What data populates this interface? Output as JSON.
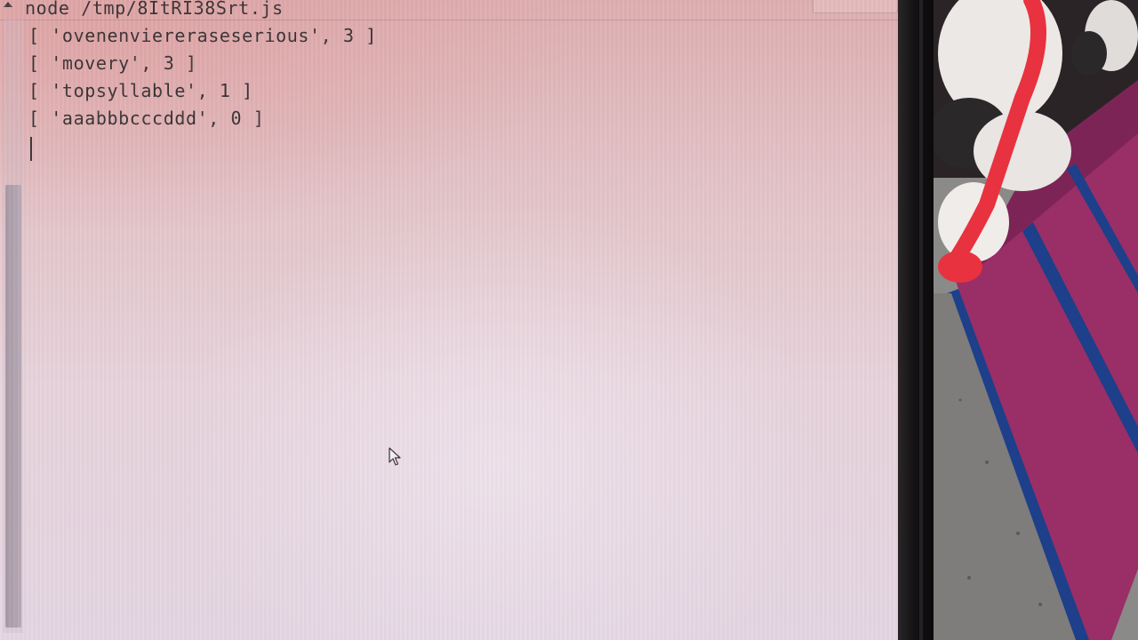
{
  "terminal": {
    "command": "node /tmp/8ItRI38Srt.js",
    "output": [
      "[ 'ovenenviereraseserious', 3 ]",
      "[ 'movery', 3 ]",
      "[ 'topsyllable', 1 ]",
      "[ 'aaabbbcccddd', 0 ]"
    ]
  },
  "icons": {
    "scroll_up": "triangle-up-icon",
    "mouse": "arrow-pointer-icon"
  },
  "colors": {
    "screen_tint": "#e3c4c8",
    "text": "#3a3336",
    "scroll_thumb": "#a89aa6",
    "bezel": "#0c0a0b",
    "carpet_magenta": "#9a2e67",
    "carpet_blue": "#1e3f8a",
    "carpet_gray": "#8a8a88",
    "plush_red": "#e8323f"
  }
}
